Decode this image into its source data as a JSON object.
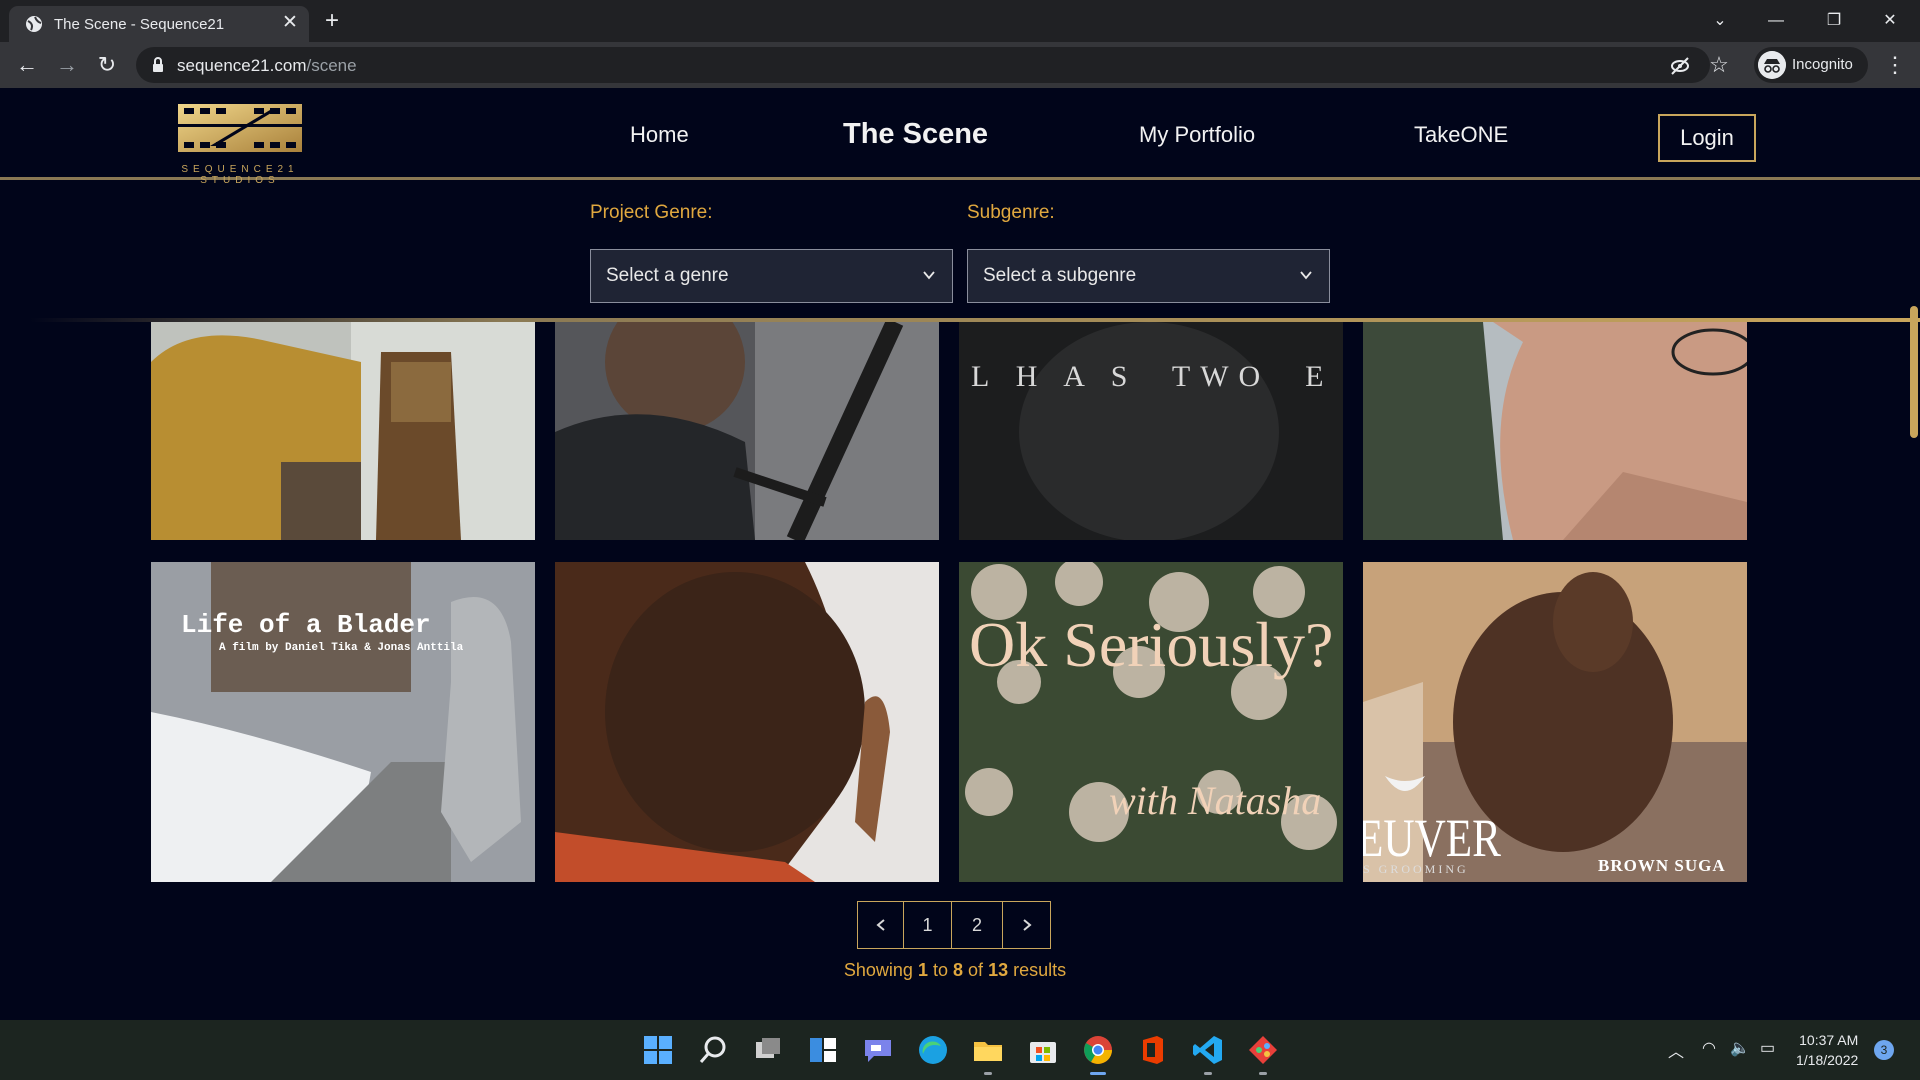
{
  "browser": {
    "tab_title": "The Scene - Sequence21",
    "url_host": "sequence21.com",
    "url_path": "/scene",
    "profile_label": "Incognito"
  },
  "site": {
    "logo_text": "SEQUENCE21 STUDIOS",
    "nav": [
      "Home",
      "The Scene",
      "My Portfolio",
      "TakeONE"
    ],
    "active_nav": "The Scene",
    "login_label": "Login",
    "filters": {
      "genre_label": "Project Genre:",
      "genre_placeholder": "Select a genre",
      "subgenre_label": "Subgenre:",
      "subgenre_placeholder": "Select a subgenre"
    },
    "cards": [
      {
        "overlay": ""
      },
      {
        "overlay": ""
      },
      {
        "overlay": "L H A S  TWO  E"
      },
      {
        "overlay": ""
      },
      {
        "overlay": "Life of a Blader",
        "sub": "A film by Daniel Tika & Jonas Anttila"
      },
      {
        "overlay": ""
      },
      {
        "overlay": "Ok Seriously?",
        "sub": "with Natasha"
      },
      {
        "overlay": "EUVER",
        "sub": "S GROOMING",
        "brand": "BROWN SUGA"
      }
    ],
    "pagination": {
      "pages": [
        "1",
        "2"
      ],
      "prev_icon": "chevron-left-icon",
      "next_icon": "chevron-right-icon"
    },
    "results": {
      "prefix": "Showing",
      "from": "1",
      "to_word": "to",
      "to": "8",
      "of_word": "of",
      "total": "13",
      "suffix": "results"
    }
  },
  "taskbar": {
    "time": "10:37 AM",
    "date": "1/18/2022",
    "notification_count": "3"
  },
  "colors": {
    "background": "#01051a",
    "accent_gold": "#c9a65c",
    "label_orange": "#e0a83f"
  }
}
